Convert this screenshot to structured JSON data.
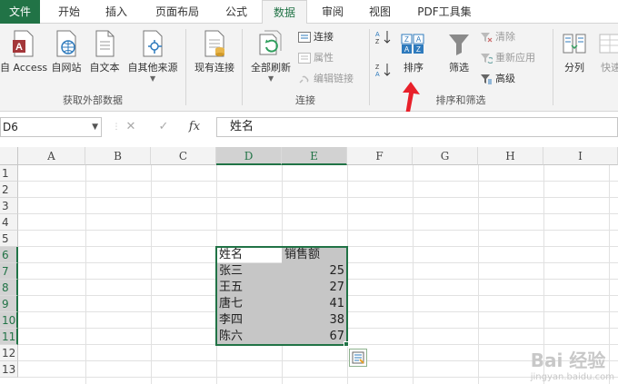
{
  "tabs": [
    "文件",
    "开始",
    "插入",
    "页面布局",
    "公式",
    "数据",
    "审阅",
    "视图",
    "PDF工具集"
  ],
  "active_tab": "数据",
  "ribbon": {
    "get_external": {
      "group_label": "获取外部数据",
      "access": "自 Access",
      "web": "自网站",
      "text": "自文本",
      "other": "自其他来源"
    },
    "existing": "现有连接",
    "connections": {
      "group_label": "连接",
      "refresh_all": "全部刷新",
      "connect": "连接",
      "properties": "属性",
      "edit_links": "编辑链接"
    },
    "sort_filter": {
      "group_label": "排序和筛选",
      "sort": "排序",
      "filter": "筛选",
      "clear": "清除",
      "reapply": "重新应用",
      "advanced": "高级"
    },
    "tools": {
      "text_to_columns": "分列",
      "flash_fill": "快速"
    }
  },
  "formula_bar": {
    "name_box": "D6",
    "cancel": "✕",
    "enter": "✓",
    "fx": "fx",
    "content": "姓名"
  },
  "columns": [
    "A",
    "B",
    "C",
    "D",
    "E",
    "F",
    "G",
    "H",
    "I"
  ],
  "rows": [
    "1",
    "2",
    "3",
    "4",
    "5",
    "6",
    "7",
    "8",
    "9",
    "10",
    "11",
    "12",
    "13"
  ],
  "table": {
    "header": [
      "姓名",
      "销售额"
    ],
    "rows": [
      [
        "张三",
        "25"
      ],
      [
        "王五",
        "27"
      ],
      [
        "唐七",
        "41"
      ],
      [
        "李四",
        "38"
      ],
      [
        "陈六",
        "67"
      ]
    ]
  },
  "colors": {
    "excel_green": "#217346",
    "selection_fill": "#c6c6c6",
    "annotation_red": "#e8202a"
  },
  "watermark": {
    "main": "Bai 经验",
    "sub": "jingyan.baidu.com"
  }
}
